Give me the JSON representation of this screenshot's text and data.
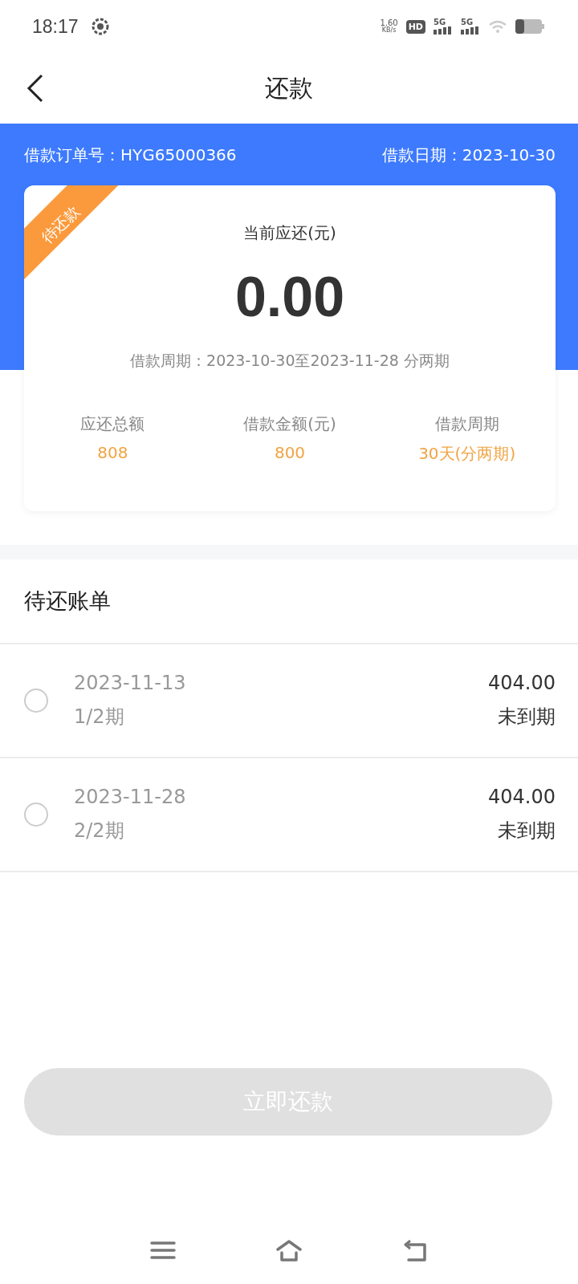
{
  "status_bar": {
    "time": "18:17",
    "net_speed": "1.60",
    "net_unit": "KB/s",
    "hd": "HD",
    "sim_labels": [
      "5G",
      "5G"
    ]
  },
  "header": {
    "title": "还款"
  },
  "order": {
    "number_label": "借款订单号：HYG65000366",
    "date_label": "借款日期：2023-10-30"
  },
  "card": {
    "ribbon": "待还款",
    "amount_label": "当前应还(元)",
    "amount": "0.00",
    "period": "借款周期：2023-10-30至2023-11-28 分两期",
    "stats": [
      {
        "label": "应还总额",
        "value": "808"
      },
      {
        "label": "借款金额(元)",
        "value": "800"
      },
      {
        "label": "借款周期",
        "value": "30天(分两期)"
      }
    ]
  },
  "bills": {
    "title": "待还账单",
    "items": [
      {
        "date": "2023-11-13",
        "term": "1/2期",
        "amount": "404.00",
        "status": "未到期",
        "selected": false
      },
      {
        "date": "2023-11-28",
        "term": "2/2期",
        "amount": "404.00",
        "status": "未到期",
        "selected": false
      }
    ]
  },
  "pay_button": {
    "label": "立即还款",
    "disabled": true
  }
}
